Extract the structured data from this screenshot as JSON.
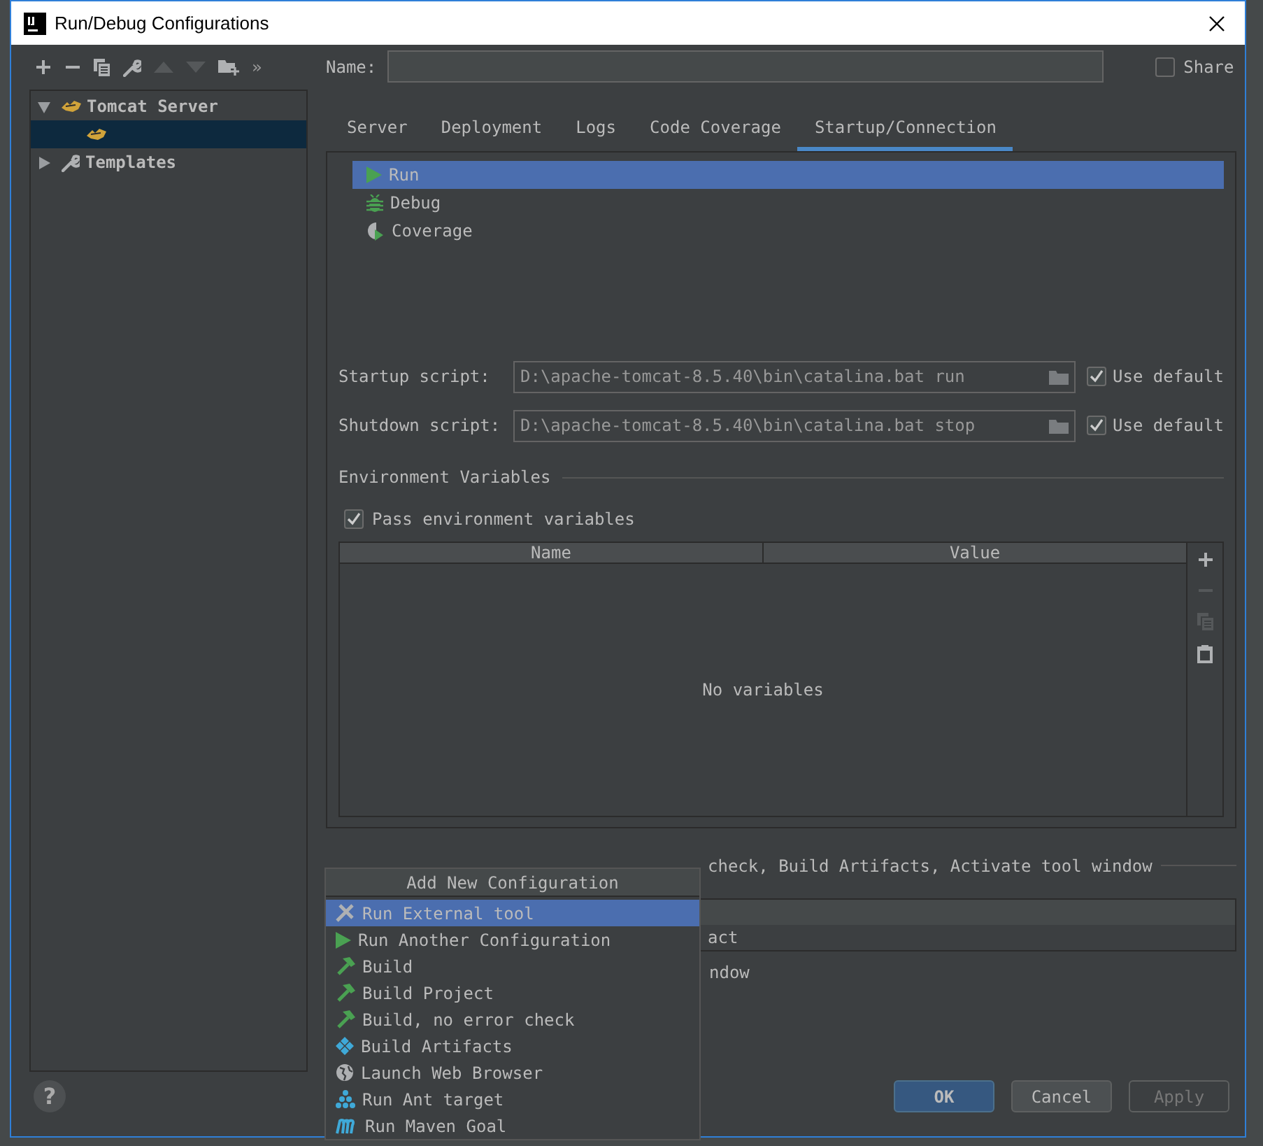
{
  "window": {
    "title": "Run/Debug Configurations"
  },
  "toolbar": [
    {
      "kind": "add",
      "disabled": false
    },
    {
      "kind": "remove",
      "disabled": false
    },
    {
      "kind": "copy",
      "disabled": false
    },
    {
      "kind": "wrench",
      "disabled": false
    },
    {
      "kind": "up",
      "disabled": true
    },
    {
      "kind": "down",
      "disabled": true
    },
    {
      "kind": "folder",
      "disabled": false
    },
    {
      "kind": "more",
      "label": "»",
      "disabled": false
    }
  ],
  "tree": [
    {
      "kind": "tomcat",
      "label": "Tomcat Server",
      "expanded": true,
      "selected": false,
      "children": [
        {
          "kind": "tomcat",
          "selected": true
        }
      ]
    },
    {
      "kind": "wrench",
      "label": "Templates",
      "expanded": false,
      "selected": false
    }
  ],
  "name_field": {
    "label": "Name:"
  },
  "share": {
    "label": "Share",
    "checked": false
  },
  "tabs": [
    {
      "label": "Server",
      "selected": false
    },
    {
      "label": "Deployment",
      "selected": false
    },
    {
      "label": "Logs",
      "selected": false
    },
    {
      "label": "Code Coverage",
      "selected": false
    },
    {
      "label": "Startup/Connection",
      "selected": true
    }
  ],
  "launch_modes": [
    {
      "kind": "run",
      "label": "Run",
      "selected": true
    },
    {
      "kind": "debug",
      "label": "Debug",
      "selected": false
    },
    {
      "kind": "coverage",
      "label": "Coverage",
      "selected": false
    }
  ],
  "scripts": [
    {
      "label": "Startup script:",
      "value": "D:\\apache-tomcat-8.5.40\\bin\\catalina.bat run",
      "use_default": {
        "label": "Use default",
        "checked": true
      }
    },
    {
      "label": "Shutdown script:",
      "value": "D:\\apache-tomcat-8.5.40\\bin\\catalina.bat stop",
      "use_default": {
        "label": "Use default",
        "checked": true
      }
    }
  ],
  "environment": {
    "title": "Environment Variables",
    "pass": {
      "label": "Pass environment variables",
      "checked": true
    },
    "columns": [
      "Name",
      "Value"
    ],
    "empty_text": "No variables",
    "tools": [
      {
        "kind": "add",
        "disabled": false
      },
      {
        "kind": "remove",
        "disabled": true
      },
      {
        "kind": "copy",
        "disabled": true
      },
      {
        "kind": "paste",
        "disabled": false
      }
    ]
  },
  "before_launch": {
    "text": "check, Build Artifacts, Activate tool window",
    "list_rows": [
      {
        "text": "act"
      }
    ],
    "trailing_text": "ndow"
  },
  "popup": {
    "title": "Add New Configuration",
    "items": [
      {
        "kind": "tool",
        "label": "Run External tool",
        "selected": true
      },
      {
        "kind": "run",
        "label": "Run Another Configuration",
        "selected": false
      },
      {
        "kind": "build",
        "label": "Build",
        "selected": false
      },
      {
        "kind": "build",
        "label": "Build Project",
        "selected": false
      },
      {
        "kind": "build",
        "label": "Build, no error check",
        "selected": false
      },
      {
        "kind": "artifacts",
        "label": "Build Artifacts",
        "selected": false
      },
      {
        "kind": "browser",
        "label": "Launch Web Browser",
        "selected": false
      },
      {
        "kind": "ant",
        "label": "Run Ant target",
        "selected": false
      },
      {
        "kind": "maven",
        "label": "Run Maven Goal",
        "selected": false
      }
    ]
  },
  "help": "?",
  "buttons": [
    {
      "kind": "default",
      "label": "OK"
    },
    {
      "kind": "normal",
      "label": "Cancel"
    },
    {
      "kind": "disabled",
      "label": "Apply"
    }
  ]
}
